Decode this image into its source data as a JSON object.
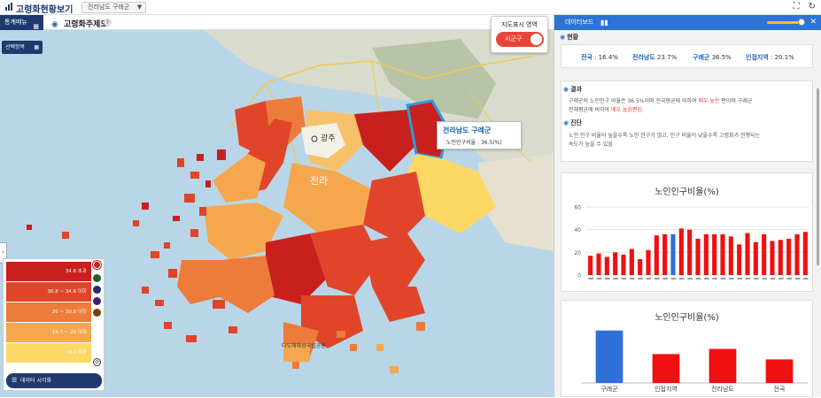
{
  "app": {
    "title": "고령화현황보기",
    "region_select": "전라남도 구례군"
  },
  "subbar": {
    "menu_label": "통계메뉴",
    "tab_label": "고령화주제도",
    "help": "?"
  },
  "map": {
    "select_btn": "선택항목",
    "city_label": "광주",
    "region_label": "전라",
    "island_label": "다도해해상국립공원"
  },
  "toggle": {
    "title": "지도표시 영역",
    "value": "시군구"
  },
  "tooltip": {
    "title": "전라남도 구례군",
    "detail": "노인인구비율 : 36.5(%)"
  },
  "legend": {
    "rows": [
      {
        "label": "34.6 초과",
        "color": "#c9201e"
      },
      {
        "label": "30.8 ~ 34.6 이하",
        "color": "#e0452a"
      },
      {
        "label": "26 ~ 30.8 이하",
        "color": "#ed7b3a"
      },
      {
        "label": "19.7 ~ 26 이하",
        "color": "#f5a74e"
      },
      {
        "label": "19.7 이하",
        "color": "#fcd864"
      }
    ],
    "marks": [
      "#c9201e",
      "#1f5e2a",
      "#1f2d7a",
      "#3d1f6e",
      "#7a3d12"
    ],
    "viz_btn": "데이터 시각화"
  },
  "panel": {
    "title": "데이터보드",
    "status_label": "현황",
    "stats": [
      {
        "name": "전국",
        "value": "16.4%"
      },
      {
        "name": "전라남도",
        "value": "23.7%"
      },
      {
        "name": "구례군",
        "value": "36.5%"
      },
      {
        "name": "인접지역",
        "value": "20.1%"
      }
    ],
    "result_label": "결과",
    "result_lines": [
      "구례군의 노인인구 비율은 36.5%이며 전국평균에 비하여 매우 높은 편이며 구례군",
      "전체평균에 비하여 매우 높음편입"
    ],
    "diag_label": "진단",
    "diag_lines": [
      "노인 인구 비율이 높을수록 노인 인구가 많고, 인구 비율이 낮을수록 고령화가 진행되는",
      "속도가 높을 수 있음"
    ],
    "chart1_title": "노인인구비율(%)",
    "chart2_title": "노인인구비율(%)"
  },
  "chart_data": [
    {
      "type": "bar",
      "title": "노인인구비율(%)",
      "ylim": [
        0,
        60
      ],
      "yticks": [
        0,
        20,
        40,
        60
      ],
      "values": [
        17,
        19,
        16,
        20,
        18,
        23,
        14,
        22,
        35,
        36,
        36,
        41,
        40,
        32,
        36,
        36,
        36,
        34,
        27,
        37,
        29,
        36,
        30,
        31,
        32,
        36,
        38
      ],
      "highlight_index": 10,
      "colors": {
        "default": "#ee1111",
        "highlight": "#2f6fd8"
      }
    },
    {
      "type": "bar",
      "title": "노인인구비율(%)",
      "categories": [
        "구례군",
        "인접지역",
        "전라남도",
        "전국"
      ],
      "values": [
        36.5,
        20.1,
        23.7,
        16.4
      ],
      "colors": [
        "#2f6fd8",
        "#ee1111",
        "#ee1111",
        "#ee1111"
      ]
    }
  ]
}
